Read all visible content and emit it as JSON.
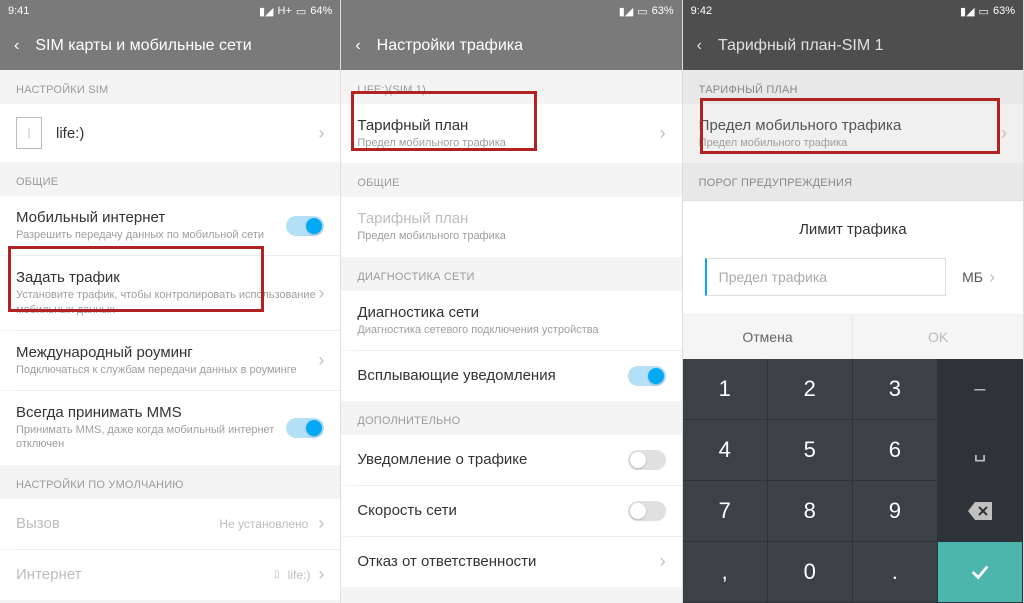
{
  "screen1": {
    "time": "9:41",
    "net": "H+",
    "battery": "64%",
    "title": "SIM карты и мобильные сети",
    "sim_section": "НАСТРОЙКИ SIM",
    "sim_label": "life:)",
    "general_section": "ОБЩИЕ",
    "mobile_data": {
      "title": "Мобильный интернет",
      "sub": "Разрешить передачу данных по мобильной сети"
    },
    "set_traffic": {
      "title": "Задать трафик",
      "sub": "Установите трафик, чтобы контролировать использование мобильных данных"
    },
    "roaming": {
      "title": "Международный роуминг",
      "sub": "Подключаться к службам передачи данных в роуминге"
    },
    "mms": {
      "title": "Всегда принимать MMS",
      "sub": "Принимать MMS, даже когда мобильный интернет отключен"
    },
    "defaults_section": "НАСТРОЙКИ ПО УМОЛЧАНИЮ",
    "call": {
      "title": "Вызов",
      "value": "Не установлено"
    },
    "internet": {
      "title": "Интернет",
      "value": "life:)"
    }
  },
  "screen2": {
    "time": "",
    "battery": "63%",
    "title": "Настройки трафика",
    "sim_section": "LIFE:)(SIM 1)",
    "tariff": {
      "title": "Тарифный план",
      "sub": "Предел мобильного трафика"
    },
    "general_section": "ОБЩИЕ",
    "tariff2": {
      "title": "Тарифный план",
      "sub": "Предел мобильного трафика"
    },
    "diag_section": "ДИАГНОСТИКА СЕТИ",
    "diag": {
      "title": "Диагностика сети",
      "sub": "Диагностика сетевого подключения устройства"
    },
    "popup": "Всплывающие уведомления",
    "extra_section": "ДОПОЛНИТЕЛЬНО",
    "notify": "Уведомление о трафике",
    "speed": "Скорость сети",
    "disclaimer": "Отказ от ответственности"
  },
  "screen3": {
    "time": "9:42",
    "battery": "63%",
    "title": "Тарифный план-SIM 1",
    "plan_section": "ТАРИФНЫЙ ПЛАН",
    "limit": {
      "title": "Предел мобильного трафика",
      "sub": "Предел мобильного трафика"
    },
    "warn_section": "ПОРОГ ПРЕДУПРЕЖДЕНИЯ",
    "dialog": {
      "title": "Лимит трафика",
      "placeholder": "Предел трафика",
      "unit": "МБ",
      "cancel": "Отмена",
      "ok": "OK"
    },
    "keys": [
      "1",
      "2",
      "3",
      "4",
      "5",
      "6",
      "7",
      "8",
      "9",
      ",",
      "0",
      "."
    ]
  }
}
